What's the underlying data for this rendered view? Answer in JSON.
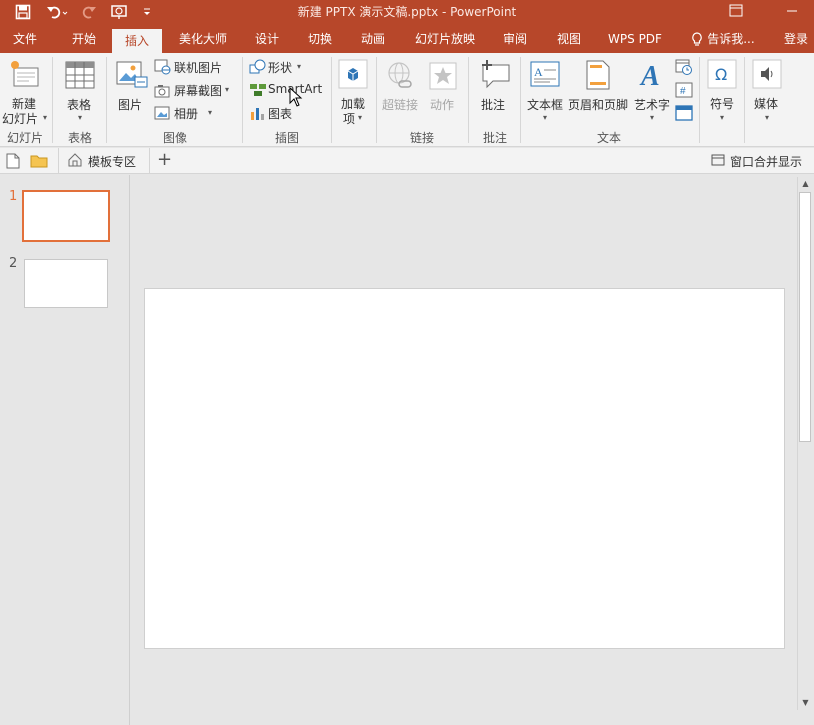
{
  "window": {
    "title": "新建 PPTX 演示文稿.pptx - PowerPoint",
    "login": "登录"
  },
  "tabs": [
    "文件",
    "开始",
    "插入",
    "美化大师",
    "设计",
    "切换",
    "动画",
    "幻灯片放映",
    "审阅",
    "视图",
    "WPS PDF",
    "告诉我..."
  ],
  "active_tab": "插入",
  "ribbon": {
    "slides": {
      "new_slide": [
        "新建",
        "幻灯片"
      ],
      "group": "幻灯片"
    },
    "tables": {
      "table": "表格",
      "group": "表格"
    },
    "images": {
      "picture": "图片",
      "online_picture": "联机图片",
      "screenshot": "屏幕截图",
      "album": "相册",
      "group": "图像"
    },
    "illustrations": {
      "shapes": "形状",
      "smartart": "SmartArt",
      "chart": "图表",
      "group": "插图"
    },
    "addins": {
      "addins": [
        "加载",
        "项"
      ]
    },
    "links": {
      "hyperlink": "超链接",
      "action": "动作",
      "group": "链接"
    },
    "comments": {
      "comment": "批注",
      "group": "批注"
    },
    "text": {
      "textbox": "文本框",
      "header_footer": "页眉和页脚",
      "wordart": "艺术字",
      "group": "文本"
    },
    "symbols": {
      "symbol": "符号"
    },
    "media": {
      "media": "媒体"
    }
  },
  "subbar": {
    "template_zone": "模板专区",
    "merge_window": "窗口合并显示"
  },
  "slides": [
    {
      "number": "1",
      "selected": true
    },
    {
      "number": "2",
      "selected": false
    }
  ],
  "colors": {
    "accent": "#b7472a",
    "selection": "#e2703a"
  }
}
